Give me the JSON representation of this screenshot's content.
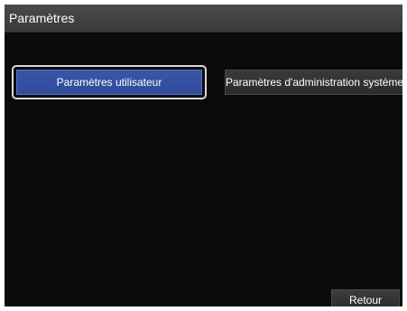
{
  "window": {
    "title": "Paramètres"
  },
  "buttons": {
    "user_settings": "Paramètres utilisateur",
    "admin_settings": "Paramètres d'administration système",
    "back": "Retour"
  },
  "colors": {
    "selected_button": "#3552a6",
    "background": "#0b0b0b",
    "titlebar": "#424242"
  }
}
